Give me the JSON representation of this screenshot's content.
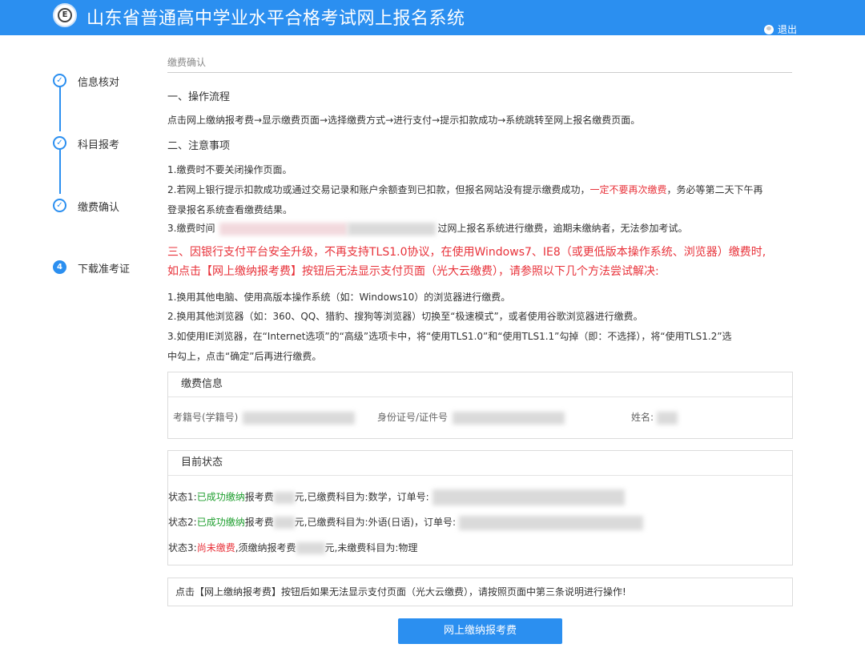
{
  "header": {
    "title": "山东省普通高中学业水平合格考试网上报名系统",
    "logout": "退出",
    "logo_letter": "E"
  },
  "steps": [
    {
      "label": "信息核对",
      "icon": "check-icon"
    },
    {
      "label": "科目报考",
      "icon": "check-icon"
    },
    {
      "label": "缴费确认",
      "icon": "check-icon"
    },
    {
      "label": "下载准考证",
      "number": "4"
    }
  ],
  "breadcrumb": "缴费确认",
  "section1": {
    "heading": "一、操作流程",
    "text": "点击网上缴纳报考费→显示缴费页面→选择缴费方式→进行支付→提示扣款成功→系统跳转至网上报名缴费页面。"
  },
  "section2": {
    "heading": "二、注意事项",
    "item1": "1.缴费时不要关闭操作页面。",
    "item2_a": "2.若网上银行提示扣款成功或通过交易记录和账户余额查到已扣款，但报名网站没有提示缴费成功，",
    "item2_red": "一定不要再次缴费",
    "item2_b": "，务必等第二天下午再",
    "item2_c": "登录报名系统查看缴费结果。",
    "item3_a": "3.缴费时间",
    "item3_b": "过网上报名系统进行缴费，逾期未缴纳者，无法参加考试。"
  },
  "section3": {
    "line1": "三、因银行支付平台安全升级，不再支持TLS1.0协议，在使用Windows7、IE8（或更低版本操作系统、浏览器）缴费时,",
    "line2": "如点击【网上缴纳报考费】按钮后无法显示支付页面（光大云缴费），请参照以下几个方法尝试解决:",
    "item1": "1.换用其他电脑、使用高版本操作系统（如：Windows10）的浏览器进行缴费。",
    "item2": "2.换用其他浏览器（如：360、QQ、猎豹、搜狗等浏览器）切换至“极速模式”，或者使用谷歌浏览器进行缴费。",
    "item3_a": "3.如使用IE浏览器，在“Internet选项”的“高级”选项卡中，将“使用TLS1.0”和“使用TLS1.1”勾掉（即：不选择），将“使用TLS1.2”选",
    "item3_b": "中勾上，点击“确定”后再进行缴费。"
  },
  "payment_info": {
    "title": "缴费信息",
    "exam_id_label": "考籍号(学籍号)",
    "id_card_label": "身份证号/证件号",
    "name_label": "姓名:"
  },
  "current_status": {
    "title": "目前状态",
    "s1_prefix": "状态1:",
    "s1_status": "已成功缴纳",
    "s1_mid": "报考费",
    "s1_rest": "元,已缴费科目为:数学，订单号:",
    "s2_prefix": "状态2:",
    "s2_status": "已成功缴纳",
    "s2_mid": "报考费",
    "s2_rest": "元,已缴费科目为:外语(日语)，订单号:",
    "s3_prefix": "状态3:",
    "s3_status": "尚未缴费",
    "s3_mid": ",须缴纳报考费",
    "s3_rest": "元,未缴费科目为:物理"
  },
  "notice": "点击【网上缴纳报考费】按钮后如果无法显示支付页面（光大云缴费），请按照页面中第三条说明进行操作!",
  "pay_button": "网上缴纳报考费",
  "colors": {
    "primary": "#2b8ff0",
    "warning": "#e8323a",
    "success": "#1e9e2e"
  }
}
